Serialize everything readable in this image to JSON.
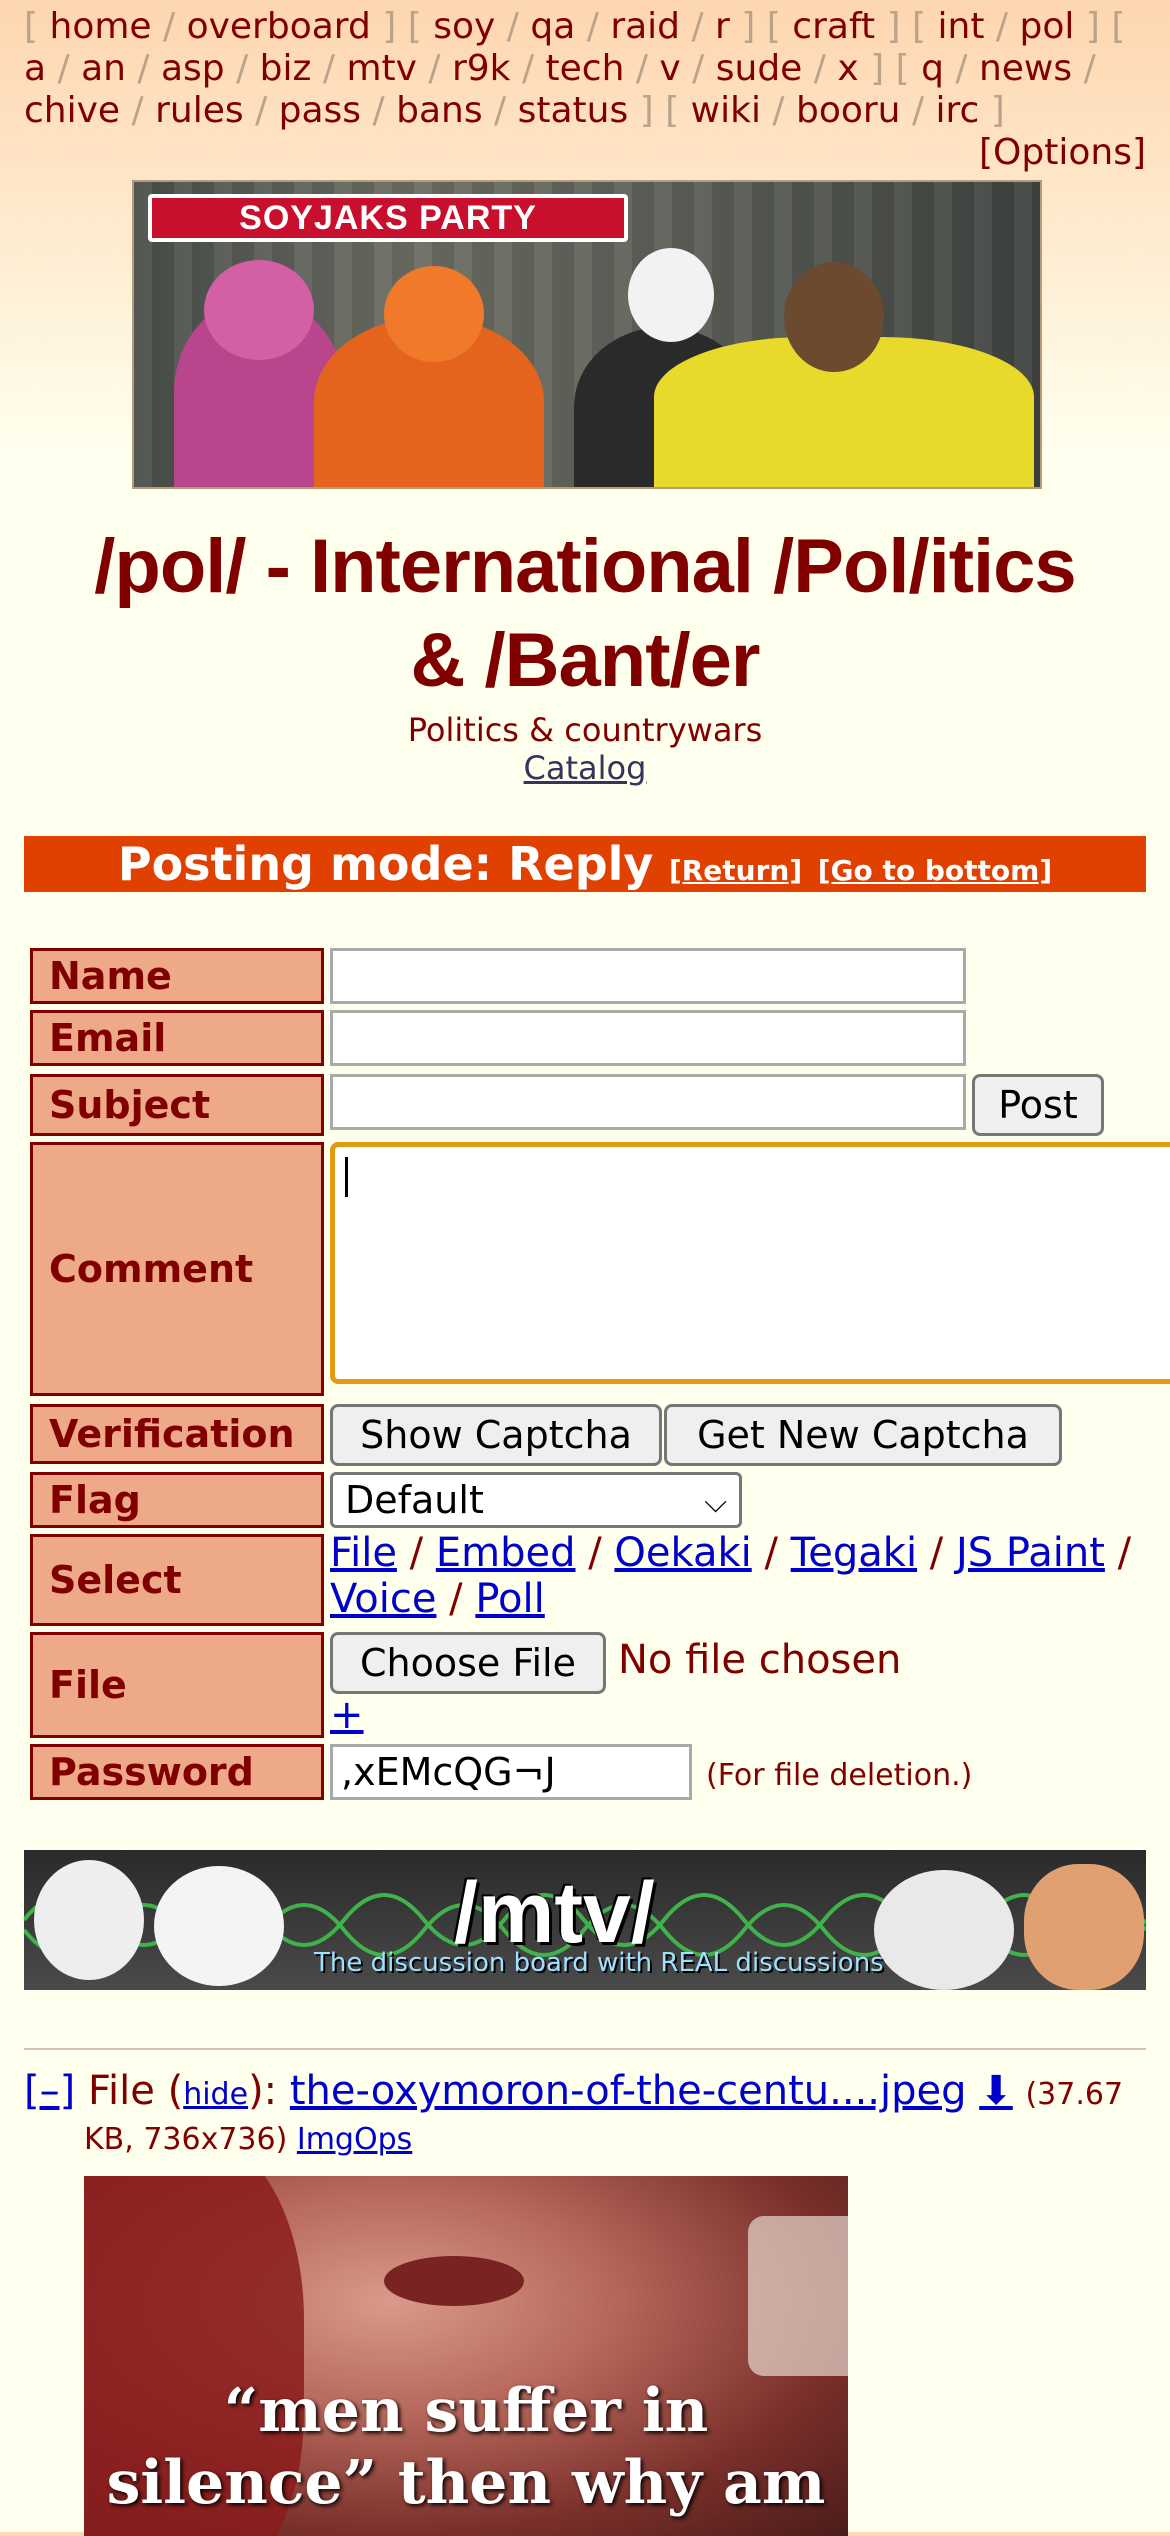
{
  "nav": {
    "groups": [
      [
        "home",
        "overboard"
      ],
      [
        "soy",
        "qa",
        "raid",
        "r"
      ],
      [
        "craft"
      ],
      [
        "int",
        "pol"
      ],
      [
        "a",
        "an",
        "asp",
        "biz",
        "mtv",
        "r9k",
        "tech",
        "v",
        "sude",
        "x"
      ],
      [
        "q",
        "news",
        "chive",
        "rules",
        "pass",
        "bans",
        "status"
      ],
      [
        "wiki",
        "booru",
        "irc"
      ]
    ],
    "options_label": "[Options]"
  },
  "banner": {
    "logo_text": "SOYJAKS PARTY"
  },
  "board": {
    "title_line1": "/pol/ - International /Pol/itics",
    "title_line2": "& /Bant/er",
    "subtitle": "Politics & countrywars",
    "catalog_link": "Catalog"
  },
  "posting_mode": {
    "label": "Posting mode: Reply",
    "return_link": "[Return]",
    "bottom_link": "[Go to bottom]"
  },
  "form": {
    "name_label": "Name",
    "email_label": "Email",
    "subject_label": "Subject",
    "post_button": "Post",
    "comment_label": "Comment",
    "verification_label": "Verification",
    "show_captcha": "Show Captcha",
    "new_captcha": "Get New Captcha",
    "flag_label": "Flag",
    "flag_value": "Default",
    "select_label": "Select",
    "select_links": [
      "File",
      "Embed",
      "Oekaki",
      "Tegaki",
      "JS Paint",
      "Voice",
      "Poll"
    ],
    "file_label": "File",
    "choose_file": "Choose File",
    "no_file": "No file chosen",
    "add_file": "+",
    "password_label": "Password",
    "password_value": ",xEMcQG¬J",
    "password_note": "(For file deletion.)"
  },
  "mtv_banner": {
    "title": "/mtv/",
    "subtitle": "The discussion board with REAL discussions"
  },
  "post": {
    "collapse": "[–]",
    "file_prefix": "File (",
    "hide_link": "hide",
    "file_colon": "):",
    "filename": "the-oxymoron-of-the-centu....jpeg",
    "size_a": "(37.67",
    "size_b": "KB, 736x736)",
    "imgops": "ImgOps",
    "caption_line1": "“men suffer in",
    "caption_line2": "silence” then why am"
  },
  "colors": {
    "accent": "#800000",
    "mode_bar": "#e04000",
    "label_bg": "#eeaa88",
    "link": "#0000cc"
  }
}
